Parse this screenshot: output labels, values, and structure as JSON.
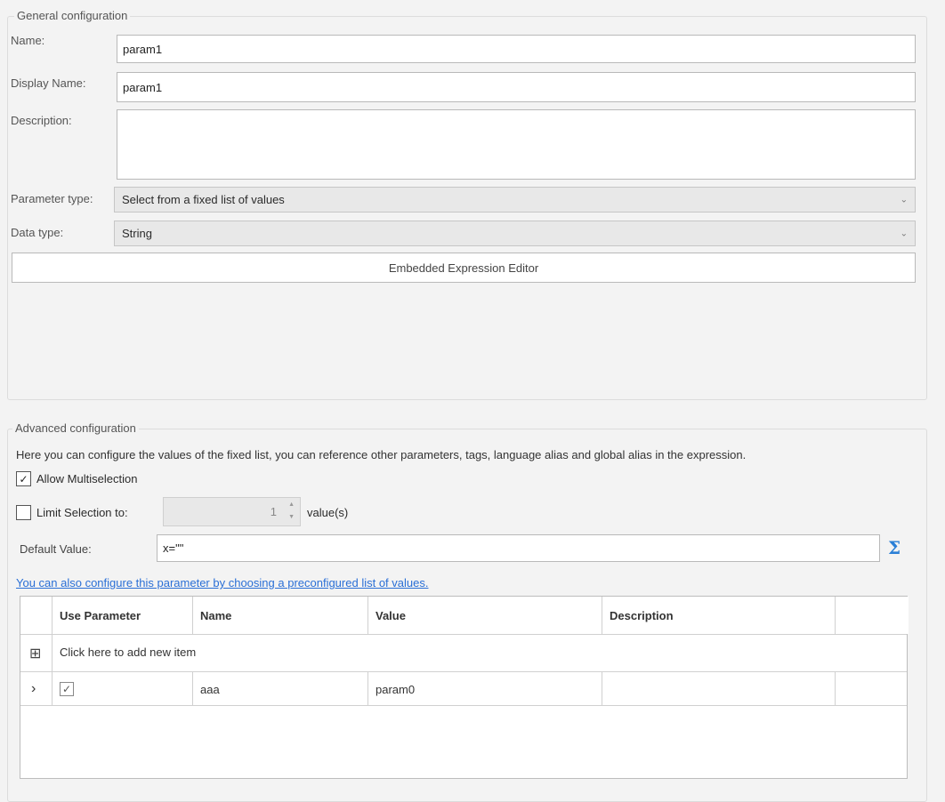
{
  "general": {
    "title": "General configuration",
    "name_label": "Name:",
    "name_value": "param1",
    "display_name_label": "Display Name:",
    "display_name_value": "param1",
    "description_label": "Description:",
    "description_value": "",
    "parameter_type_label": "Parameter type:",
    "parameter_type_value": "Select from a fixed list of values",
    "data_type_label": "Data type:",
    "data_type_value": "String",
    "embedded_button": "Embedded Expression Editor"
  },
  "advanced": {
    "title": "Advanced configuration",
    "description": "Here you can configure the values of the fixed list, you can reference other parameters, tags, language alias and global alias in the expression.",
    "allow_multiselection_label": "Allow Multiselection",
    "allow_multiselection_checked": true,
    "limit_selection_label": "Limit Selection to:",
    "limit_selection_checked": false,
    "limit_value": "1",
    "limit_unit": "value(s)",
    "default_value_label": "Default Value:",
    "default_value": "x=\"\"",
    "link_text": "You can also configure this parameter by choosing a preconfigured list of values.",
    "grid": {
      "columns": [
        "Use Parameter",
        "Name",
        "Value",
        "Description"
      ],
      "add_row_label": "Click here to add new item",
      "rows": [
        {
          "use_parameter": true,
          "name": "aaa",
          "value": "param0",
          "description": ""
        }
      ]
    }
  },
  "icons": {
    "checkmark": "✓",
    "chevron_down": "⌄",
    "spin_up": "▲",
    "spin_down": "▼",
    "expand_row": "›",
    "add_row": "⊞",
    "sigma": "Σ"
  },
  "colors": {
    "link": "#2a6fd6",
    "background": "#f3f3f3"
  }
}
